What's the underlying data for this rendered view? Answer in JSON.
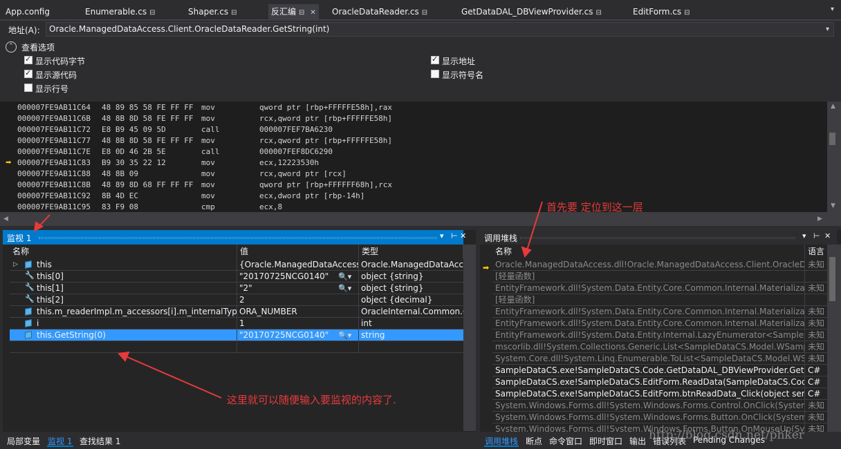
{
  "tabs": [
    {
      "label": "App.config",
      "pin": ""
    },
    {
      "label": "Enumerable.cs",
      "pin": "⊟"
    },
    {
      "label": "Shaper.cs",
      "pin": "⊟"
    },
    {
      "label": "反汇编",
      "pin": "⊟"
    },
    {
      "label": "OracleDataReader.cs",
      "pin": "⊟"
    },
    {
      "label": "GetDataDAL_DBViewProvider.cs",
      "pin": "⊟"
    },
    {
      "label": "EditForm.cs",
      "pin": "⊟"
    }
  ],
  "active_tab_close": "✕",
  "address": {
    "label": "地址(A):",
    "value": "Oracle.ManagedDataAccess.Client.OracleDataReader.GetString(int)"
  },
  "view_options": {
    "title": "查看选项",
    "options": [
      {
        "label": "显示代码字节",
        "checked": true
      },
      {
        "label": "显示源代码",
        "checked": true
      },
      {
        "label": "显示行号",
        "checked": false
      },
      {
        "label": "显示地址",
        "checked": true
      },
      {
        "label": "显示符号名",
        "checked": false
      }
    ]
  },
  "disassembly": [
    {
      "addr": "000007FE9AB11C64",
      "bytes": "48 89 85 58 FE FF FF",
      "op": "mov",
      "args": "qword ptr [rbp+FFFFFE58h],rax",
      "current": false
    },
    {
      "addr": "000007FE9AB11C6B",
      "bytes": "48 8B 8D 58 FE FF FF",
      "op": "mov",
      "args": "rcx,qword ptr [rbp+FFFFFE58h]",
      "current": false
    },
    {
      "addr": "000007FE9AB11C72",
      "bytes": "E8 B9 45 09 5D",
      "op": "call",
      "args": "000007FEF7BA6230",
      "current": false
    },
    {
      "addr": "000007FE9AB11C77",
      "bytes": "48 8B 8D 58 FE FF FF",
      "op": "mov",
      "args": "rcx,qword ptr [rbp+FFFFFE58h]",
      "current": false
    },
    {
      "addr": "000007FE9AB11C7E",
      "bytes": "E8 0D 46 2B 5E",
      "op": "call",
      "args": "000007FEF8DC6290",
      "current": false
    },
    {
      "addr": "000007FE9AB11C83",
      "bytes": "B9 30 35 22 12",
      "op": "mov",
      "args": "ecx,12223530h",
      "current": true
    },
    {
      "addr": "000007FE9AB11C88",
      "bytes": "48 8B 09",
      "op": "mov",
      "args": "rcx,qword ptr [rcx]",
      "current": false
    },
    {
      "addr": "000007FE9AB11C8B",
      "bytes": "48 89 8D 68 FF FF FF",
      "op": "mov",
      "args": "qword ptr [rbp+FFFFFF68h],rcx",
      "current": false
    },
    {
      "addr": "000007FE9AB11C92",
      "bytes": "8B 4D EC",
      "op": "mov",
      "args": "ecx,dword ptr [rbp-14h]",
      "current": false
    },
    {
      "addr": "000007FE9AB11C95",
      "bytes": "83 F9 08",
      "op": "cmp",
      "args": "ecx,8",
      "current": false
    }
  ],
  "watch": {
    "title": "监视 1",
    "controls": [
      "▾",
      "⊢",
      "✕"
    ],
    "columns": [
      "名称",
      "值",
      "类型"
    ],
    "rows": [
      {
        "icon": "cube",
        "expand": "▷",
        "name": "this",
        "value": "{Oracle.ManagedDataAccess.Client.OracleDataReader}",
        "search": false,
        "type": "Oracle.ManagedDataAccess.Client.OracleDataReader",
        "selected": false
      },
      {
        "icon": "wrench",
        "expand": "",
        "name": "this[0]",
        "value": "\"20170725NCG0140\"",
        "search": true,
        "type": "object {string}",
        "selected": false
      },
      {
        "icon": "wrench",
        "expand": "",
        "name": "this[1]",
        "value": "\"2\"",
        "search": true,
        "type": "object {string}",
        "selected": false
      },
      {
        "icon": "wrench",
        "expand": "",
        "name": "this[2]",
        "value": "2",
        "search": false,
        "type": "object {decimal}",
        "selected": false
      },
      {
        "icon": "cube",
        "expand": "",
        "name": "this.m_readerImpl.m_accessors[i].m_internalType",
        "value": "ORA_NUMBER",
        "search": false,
        "type": "OracleInternal.Common.OraType",
        "selected": false
      },
      {
        "icon": "cube",
        "expand": "",
        "name": "i",
        "value": "1",
        "search": false,
        "type": "int",
        "selected": false
      },
      {
        "icon": "cube",
        "expand": "",
        "name": "this.GetString(0)",
        "value": "\"20170725NCG0140\"",
        "search": true,
        "type": "string",
        "selected": true
      },
      {
        "icon": "",
        "expand": "",
        "name": "",
        "value": "",
        "search": false,
        "type": "",
        "selected": false
      }
    ],
    "search_glyph": "🔍▾"
  },
  "callstack": {
    "title": "调用堆栈",
    "controls": [
      "▾",
      "⊢",
      "✕"
    ],
    "columns": [
      "名称",
      "语言"
    ],
    "current_marker": "➡",
    "rows": [
      {
        "name": "Oracle.ManagedDataAccess.dll!Oracle.ManagedDataAccess.Client.OracleDataReader.GetString(int i)",
        "lang": "未知",
        "kind": "ext"
      },
      {
        "name": "[轻量函数]",
        "lang": "",
        "kind": "ext"
      },
      {
        "name": "EntityFramework.dll!System.Data.Entity.Core.Common.Internal.Materialization.Shaper.GetColumnValueWithErrorHandling<string>(int ordinal)",
        "lang": "未知",
        "kind": "ext"
      },
      {
        "name": "[轻量函数]",
        "lang": "",
        "kind": "ext"
      },
      {
        "name": "EntityFramework.dll!System.Data.Entity.Core.Common.Internal.Materialization.Coordinator<T>.ReadNextElement(Shaper shaper)",
        "lang": "未知",
        "kind": "ext"
      },
      {
        "name": "EntityFramework.dll!System.Data.Entity.Core.Common.Internal.Materialization.Shaper<T>.SimpleEnumerator.MoveNext()",
        "lang": "未知",
        "kind": "ext"
      },
      {
        "name": "EntityFramework.dll!System.Data.Entity.Internal.LazyEnumerator<SampleDataCS.Model.WSampleInputOrder>.MoveNext()",
        "lang": "未知",
        "kind": "ext"
      },
      {
        "name": "mscorlib.dll!System.Collections.Generic.List<SampleDataCS.Model.WSampleInputOrder>.List(IEnumerable<T> collection)",
        "lang": "未知",
        "kind": "ext"
      },
      {
        "name": "System.Core.dll!System.Linq.Enumerable.ToList<SampleDataCS.Model.WSampleInputOrder>(IEnumerable<T> source)",
        "lang": "未知",
        "kind": "ext"
      },
      {
        "name": "SampleDataCS.exe!SampleDataCS.Code.GetDataDAL_DBViewProvider.GetSampleData(string strCode)",
        "lang": "C#",
        "kind": "user"
      },
      {
        "name": "SampleDataCS.exe!SampleDataCS.EditForm.ReadData(SampleDataCS.Code.Model.QueryCondition cond)",
        "lang": "C#",
        "kind": "user"
      },
      {
        "name": "SampleDataCS.exe!SampleDataCS.EditForm.btnReadData_Click(object sender, System.EventArgs e)",
        "lang": "C#",
        "kind": "user"
      },
      {
        "name": "System.Windows.Forms.dll!System.Windows.Forms.Control.OnClick(System.EventArgs e)",
        "lang": "未知",
        "kind": "ext"
      },
      {
        "name": "System.Windows.Forms.dll!System.Windows.Forms.Button.OnClick(System.EventArgs e)",
        "lang": "未知",
        "kind": "ext"
      },
      {
        "name": "System.Windows.Forms.dll!System.Windows.Forms.Button.OnMouseUp(System.Windows.Forms.MouseEventArgs mevent)",
        "lang": "未知",
        "kind": "ext"
      }
    ]
  },
  "bottom_tabs_left": [
    {
      "label": "局部变量",
      "active": false
    },
    {
      "label": "监视 1",
      "active": true
    },
    {
      "label": "查找结果 1",
      "active": false
    }
  ],
  "bottom_tabs_right": [
    {
      "label": "调用堆栈",
      "active": true
    },
    {
      "label": "断点",
      "active": false
    },
    {
      "label": "命令窗口",
      "active": false
    },
    {
      "label": "即时窗口",
      "active": false
    },
    {
      "label": "输出",
      "active": false
    },
    {
      "label": "错误列表",
      "active": false
    },
    {
      "label": "Pending Changes",
      "active": false
    }
  ],
  "annotations": {
    "top_note": "首先要 定位到这一层",
    "watch_note": "这里就可以随便输入要监视的内容了.",
    "watermark": "http://blog.csdn.net/phker",
    "color": "#e83a3a"
  },
  "colors": {
    "accent": "#007acc",
    "selection": "#3399ff",
    "background": "#2d2d30",
    "editor": "#1e1e1e"
  }
}
